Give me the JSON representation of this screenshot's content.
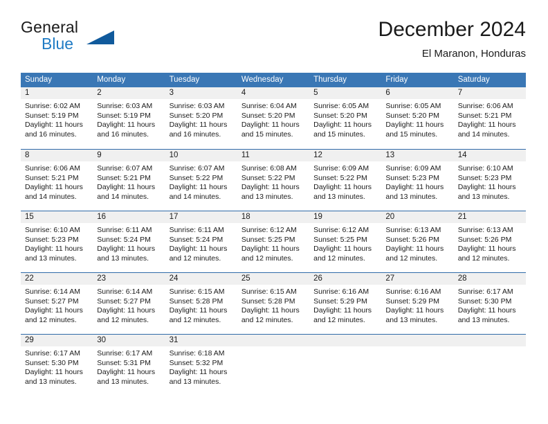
{
  "logo": {
    "word1": "General",
    "word2": "Blue",
    "accent_color": "#1f7bc4",
    "triangle_color": "#105a9c"
  },
  "header": {
    "month_title": "December 2024",
    "location": "El Maranon, Honduras"
  },
  "theme": {
    "header_blue": "#3a77b5",
    "row_divider_blue": "#2f6aa8",
    "day_band_gray": "#f0f0f0"
  },
  "calendar": {
    "weekdays": [
      "Sunday",
      "Monday",
      "Tuesday",
      "Wednesday",
      "Thursday",
      "Friday",
      "Saturday"
    ],
    "weeks": [
      [
        {
          "day": "1",
          "sunrise": "Sunrise: 6:02 AM",
          "sunset": "Sunset: 5:19 PM",
          "daylight1": "Daylight: 11 hours",
          "daylight2": "and 16 minutes."
        },
        {
          "day": "2",
          "sunrise": "Sunrise: 6:03 AM",
          "sunset": "Sunset: 5:19 PM",
          "daylight1": "Daylight: 11 hours",
          "daylight2": "and 16 minutes."
        },
        {
          "day": "3",
          "sunrise": "Sunrise: 6:03 AM",
          "sunset": "Sunset: 5:20 PM",
          "daylight1": "Daylight: 11 hours",
          "daylight2": "and 16 minutes."
        },
        {
          "day": "4",
          "sunrise": "Sunrise: 6:04 AM",
          "sunset": "Sunset: 5:20 PM",
          "daylight1": "Daylight: 11 hours",
          "daylight2": "and 15 minutes."
        },
        {
          "day": "5",
          "sunrise": "Sunrise: 6:05 AM",
          "sunset": "Sunset: 5:20 PM",
          "daylight1": "Daylight: 11 hours",
          "daylight2": "and 15 minutes."
        },
        {
          "day": "6",
          "sunrise": "Sunrise: 6:05 AM",
          "sunset": "Sunset: 5:20 PM",
          "daylight1": "Daylight: 11 hours",
          "daylight2": "and 15 minutes."
        },
        {
          "day": "7",
          "sunrise": "Sunrise: 6:06 AM",
          "sunset": "Sunset: 5:21 PM",
          "daylight1": "Daylight: 11 hours",
          "daylight2": "and 14 minutes."
        }
      ],
      [
        {
          "day": "8",
          "sunrise": "Sunrise: 6:06 AM",
          "sunset": "Sunset: 5:21 PM",
          "daylight1": "Daylight: 11 hours",
          "daylight2": "and 14 minutes."
        },
        {
          "day": "9",
          "sunrise": "Sunrise: 6:07 AM",
          "sunset": "Sunset: 5:21 PM",
          "daylight1": "Daylight: 11 hours",
          "daylight2": "and 14 minutes."
        },
        {
          "day": "10",
          "sunrise": "Sunrise: 6:07 AM",
          "sunset": "Sunset: 5:22 PM",
          "daylight1": "Daylight: 11 hours",
          "daylight2": "and 14 minutes."
        },
        {
          "day": "11",
          "sunrise": "Sunrise: 6:08 AM",
          "sunset": "Sunset: 5:22 PM",
          "daylight1": "Daylight: 11 hours",
          "daylight2": "and 13 minutes."
        },
        {
          "day": "12",
          "sunrise": "Sunrise: 6:09 AM",
          "sunset": "Sunset: 5:22 PM",
          "daylight1": "Daylight: 11 hours",
          "daylight2": "and 13 minutes."
        },
        {
          "day": "13",
          "sunrise": "Sunrise: 6:09 AM",
          "sunset": "Sunset: 5:23 PM",
          "daylight1": "Daylight: 11 hours",
          "daylight2": "and 13 minutes."
        },
        {
          "day": "14",
          "sunrise": "Sunrise: 6:10 AM",
          "sunset": "Sunset: 5:23 PM",
          "daylight1": "Daylight: 11 hours",
          "daylight2": "and 13 minutes."
        }
      ],
      [
        {
          "day": "15",
          "sunrise": "Sunrise: 6:10 AM",
          "sunset": "Sunset: 5:23 PM",
          "daylight1": "Daylight: 11 hours",
          "daylight2": "and 13 minutes."
        },
        {
          "day": "16",
          "sunrise": "Sunrise: 6:11 AM",
          "sunset": "Sunset: 5:24 PM",
          "daylight1": "Daylight: 11 hours",
          "daylight2": "and 13 minutes."
        },
        {
          "day": "17",
          "sunrise": "Sunrise: 6:11 AM",
          "sunset": "Sunset: 5:24 PM",
          "daylight1": "Daylight: 11 hours",
          "daylight2": "and 12 minutes."
        },
        {
          "day": "18",
          "sunrise": "Sunrise: 6:12 AM",
          "sunset": "Sunset: 5:25 PM",
          "daylight1": "Daylight: 11 hours",
          "daylight2": "and 12 minutes."
        },
        {
          "day": "19",
          "sunrise": "Sunrise: 6:12 AM",
          "sunset": "Sunset: 5:25 PM",
          "daylight1": "Daylight: 11 hours",
          "daylight2": "and 12 minutes."
        },
        {
          "day": "20",
          "sunrise": "Sunrise: 6:13 AM",
          "sunset": "Sunset: 5:26 PM",
          "daylight1": "Daylight: 11 hours",
          "daylight2": "and 12 minutes."
        },
        {
          "day": "21",
          "sunrise": "Sunrise: 6:13 AM",
          "sunset": "Sunset: 5:26 PM",
          "daylight1": "Daylight: 11 hours",
          "daylight2": "and 12 minutes."
        }
      ],
      [
        {
          "day": "22",
          "sunrise": "Sunrise: 6:14 AM",
          "sunset": "Sunset: 5:27 PM",
          "daylight1": "Daylight: 11 hours",
          "daylight2": "and 12 minutes."
        },
        {
          "day": "23",
          "sunrise": "Sunrise: 6:14 AM",
          "sunset": "Sunset: 5:27 PM",
          "daylight1": "Daylight: 11 hours",
          "daylight2": "and 12 minutes."
        },
        {
          "day": "24",
          "sunrise": "Sunrise: 6:15 AM",
          "sunset": "Sunset: 5:28 PM",
          "daylight1": "Daylight: 11 hours",
          "daylight2": "and 12 minutes."
        },
        {
          "day": "25",
          "sunrise": "Sunrise: 6:15 AM",
          "sunset": "Sunset: 5:28 PM",
          "daylight1": "Daylight: 11 hours",
          "daylight2": "and 12 minutes."
        },
        {
          "day": "26",
          "sunrise": "Sunrise: 6:16 AM",
          "sunset": "Sunset: 5:29 PM",
          "daylight1": "Daylight: 11 hours",
          "daylight2": "and 12 minutes."
        },
        {
          "day": "27",
          "sunrise": "Sunrise: 6:16 AM",
          "sunset": "Sunset: 5:29 PM",
          "daylight1": "Daylight: 11 hours",
          "daylight2": "and 13 minutes."
        },
        {
          "day": "28",
          "sunrise": "Sunrise: 6:17 AM",
          "sunset": "Sunset: 5:30 PM",
          "daylight1": "Daylight: 11 hours",
          "daylight2": "and 13 minutes."
        }
      ],
      [
        {
          "day": "29",
          "sunrise": "Sunrise: 6:17 AM",
          "sunset": "Sunset: 5:30 PM",
          "daylight1": "Daylight: 11 hours",
          "daylight2": "and 13 minutes."
        },
        {
          "day": "30",
          "sunrise": "Sunrise: 6:17 AM",
          "sunset": "Sunset: 5:31 PM",
          "daylight1": "Daylight: 11 hours",
          "daylight2": "and 13 minutes."
        },
        {
          "day": "31",
          "sunrise": "Sunrise: 6:18 AM",
          "sunset": "Sunset: 5:32 PM",
          "daylight1": "Daylight: 11 hours",
          "daylight2": "and 13 minutes."
        },
        {
          "day": "",
          "sunrise": "",
          "sunset": "",
          "daylight1": "",
          "daylight2": ""
        },
        {
          "day": "",
          "sunrise": "",
          "sunset": "",
          "daylight1": "",
          "daylight2": ""
        },
        {
          "day": "",
          "sunrise": "",
          "sunset": "",
          "daylight1": "",
          "daylight2": ""
        },
        {
          "day": "",
          "sunrise": "",
          "sunset": "",
          "daylight1": "",
          "daylight2": ""
        }
      ]
    ]
  }
}
